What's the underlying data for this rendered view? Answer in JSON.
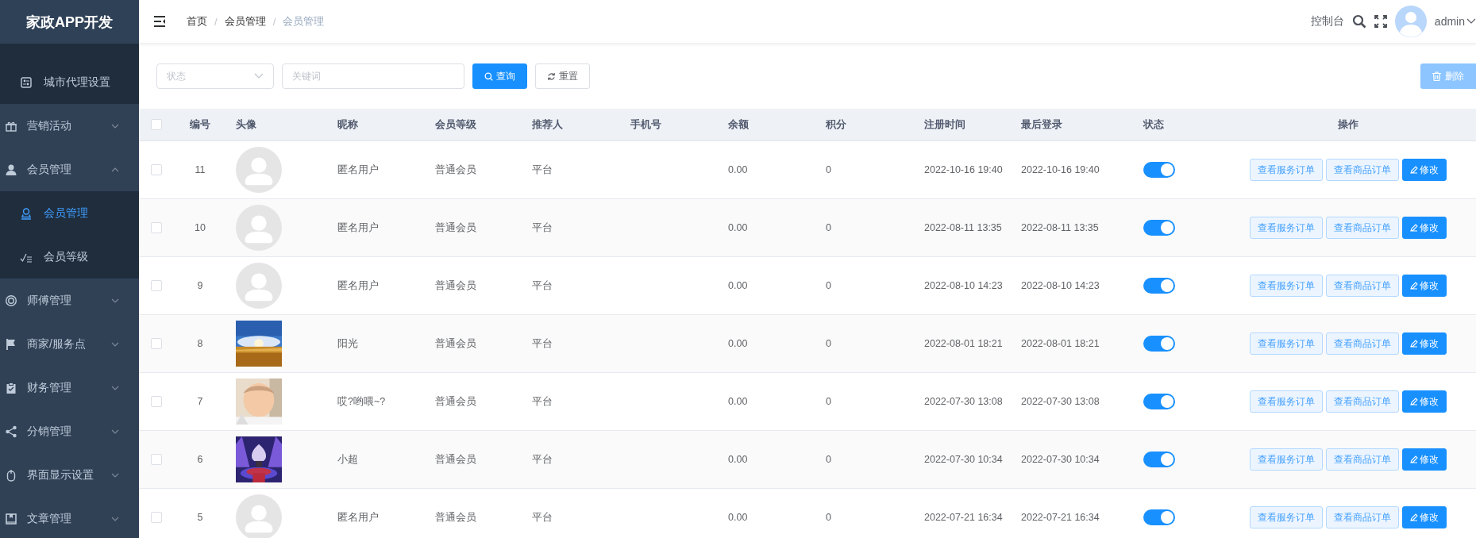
{
  "sidebar": {
    "logo": "家政APP开发",
    "items": [
      {
        "kind": "sub",
        "label": "城市代理设置",
        "selected": false
      },
      {
        "kind": "group",
        "label": "营销活动",
        "expanded": false
      },
      {
        "kind": "group",
        "label": "会员管理",
        "expanded": true,
        "children": [
          {
            "label": "会员管理",
            "selected": true
          },
          {
            "label": "会员等级",
            "selected": false
          }
        ]
      },
      {
        "kind": "group",
        "label": "师傅管理",
        "expanded": false
      },
      {
        "kind": "group",
        "label": "商家/服务点",
        "expanded": false
      },
      {
        "kind": "group",
        "label": "财务管理",
        "expanded": false
      },
      {
        "kind": "group",
        "label": "分销管理",
        "expanded": false
      },
      {
        "kind": "group",
        "label": "界面显示设置",
        "expanded": false
      },
      {
        "kind": "group",
        "label": "文章管理",
        "expanded": false
      }
    ]
  },
  "header": {
    "breadcrumb": [
      {
        "kind": "link",
        "label": "首页"
      },
      {
        "kind": "sep",
        "label": "/"
      },
      {
        "kind": "link",
        "label": "会员管理"
      },
      {
        "kind": "sep",
        "label": "/"
      },
      {
        "kind": "current",
        "label": "会员管理"
      }
    ],
    "console_link": "控制台",
    "user": "admin"
  },
  "filters": {
    "status": {
      "placeholder": "状态"
    },
    "keyword": {
      "placeholder": "关键词"
    },
    "buttons": [
      {
        "kind": "primary",
        "label": "查询"
      },
      {
        "kind": "plain",
        "label": "重置"
      }
    ],
    "delete_button": {
      "label": "删除",
      "disabled": true
    }
  },
  "table": {
    "select_all": {
      "checked": false
    },
    "columns": [
      "编号",
      "头像",
      "昵称",
      "会员等级",
      "推荐人",
      "手机号",
      "余额",
      "积分",
      "注册时间",
      "最后登录",
      "状态",
      "操作"
    ],
    "rows": [
      {
        "checked": false,
        "id": "11",
        "avatar": {
          "kind": "default"
        },
        "nickname": "匿名用户",
        "level": "普通会员",
        "referrer": "平台",
        "balance": "0.00",
        "points": "0",
        "registered": "2022-10-16 19:40",
        "last_login": "2022-10-16 19:40",
        "enabled": true,
        "actions": [
          "查看服务订单",
          "查看商品订单",
          "修改"
        ]
      },
      {
        "checked": false,
        "id": "10",
        "avatar": {
          "kind": "default"
        },
        "nickname": "匿名用户",
        "level": "普通会员",
        "referrer": "平台",
        "balance": "0.00",
        "points": "0",
        "registered": "2022-08-11 13:35",
        "last_login": "2022-08-11 13:35",
        "enabled": true,
        "actions": [
          "查看服务订单",
          "查看商品订单",
          "修改"
        ]
      },
      {
        "checked": false,
        "id": "9",
        "avatar": {
          "kind": "default"
        },
        "nickname": "匿名用户",
        "level": "普通会员",
        "referrer": "平台",
        "balance": "0.00",
        "points": "0",
        "registered": "2022-08-10 14:23",
        "last_login": "2022-08-10 14:23",
        "enabled": true,
        "actions": [
          "查看服务订单",
          "查看商品订单",
          "修改"
        ]
      },
      {
        "checked": false,
        "id": "8",
        "nickname": "阳光",
        "level": "普通会员",
        "referrer": "平台",
        "balance": "0.00",
        "points": "0",
        "registered": "2022-08-01 18:21",
        "last_login": "2022-08-01 18:21",
        "enabled": true,
        "actions": [
          "查看服务订单",
          "查看商品订单",
          "修改"
        ]
      },
      {
        "checked": false,
        "id": "7",
        "nickname": "哎?哟喂~?",
        "level": "普通会员",
        "referrer": "平台",
        "balance": "0.00",
        "points": "0",
        "registered": "2022-07-30 13:08",
        "last_login": "2022-07-30 13:08",
        "enabled": true,
        "actions": [
          "查看服务订单",
          "查看商品订单",
          "修改"
        ]
      },
      {
        "checked": false,
        "id": "6",
        "nickname": "小超",
        "level": "普通会员",
        "referrer": "平台",
        "balance": "0.00",
        "points": "0",
        "registered": "2022-07-30 10:34",
        "last_login": "2022-07-30 10:34",
        "enabled": true,
        "actions": [
          "查看服务订单",
          "查看商品订单",
          "修改"
        ]
      },
      {
        "checked": false,
        "id": "5",
        "avatar": {
          "kind": "default"
        },
        "nickname": "匿名用户",
        "level": "普通会员",
        "referrer": "平台",
        "balance": "0.00",
        "points": "0",
        "registered": "2022-07-21 16:34",
        "last_login": "2022-07-21 16:34",
        "enabled": true,
        "actions": [
          "查看服务订单",
          "查看商品订单",
          "修改"
        ]
      }
    ]
  }
}
